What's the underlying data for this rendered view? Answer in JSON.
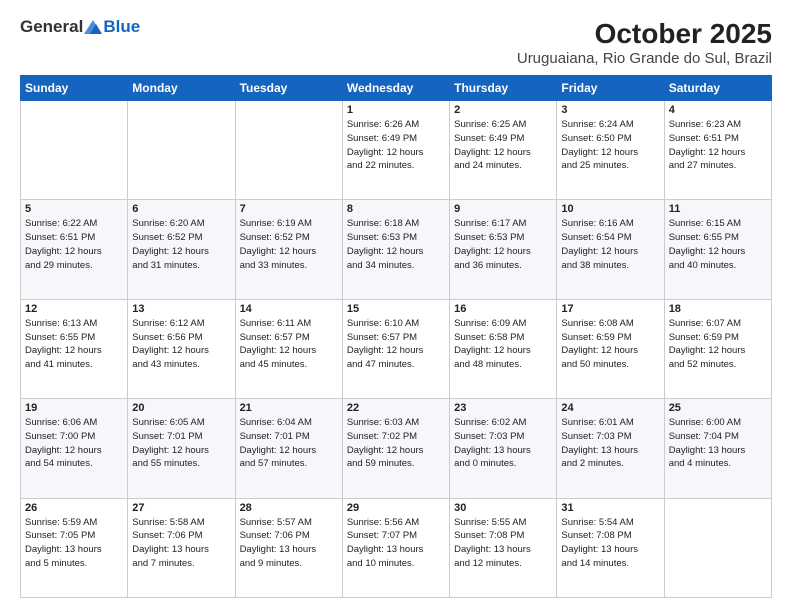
{
  "logo": {
    "general": "General",
    "blue": "Blue"
  },
  "title": "October 2025",
  "subtitle": "Uruguaiana, Rio Grande do Sul, Brazil",
  "headers": [
    "Sunday",
    "Monday",
    "Tuesday",
    "Wednesday",
    "Thursday",
    "Friday",
    "Saturday"
  ],
  "rows": [
    [
      {
        "day": "",
        "info": ""
      },
      {
        "day": "",
        "info": ""
      },
      {
        "day": "",
        "info": ""
      },
      {
        "day": "1",
        "info": "Sunrise: 6:26 AM\nSunset: 6:49 PM\nDaylight: 12 hours\nand 22 minutes."
      },
      {
        "day": "2",
        "info": "Sunrise: 6:25 AM\nSunset: 6:49 PM\nDaylight: 12 hours\nand 24 minutes."
      },
      {
        "day": "3",
        "info": "Sunrise: 6:24 AM\nSunset: 6:50 PM\nDaylight: 12 hours\nand 25 minutes."
      },
      {
        "day": "4",
        "info": "Sunrise: 6:23 AM\nSunset: 6:51 PM\nDaylight: 12 hours\nand 27 minutes."
      }
    ],
    [
      {
        "day": "5",
        "info": "Sunrise: 6:22 AM\nSunset: 6:51 PM\nDaylight: 12 hours\nand 29 minutes."
      },
      {
        "day": "6",
        "info": "Sunrise: 6:20 AM\nSunset: 6:52 PM\nDaylight: 12 hours\nand 31 minutes."
      },
      {
        "day": "7",
        "info": "Sunrise: 6:19 AM\nSunset: 6:52 PM\nDaylight: 12 hours\nand 33 minutes."
      },
      {
        "day": "8",
        "info": "Sunrise: 6:18 AM\nSunset: 6:53 PM\nDaylight: 12 hours\nand 34 minutes."
      },
      {
        "day": "9",
        "info": "Sunrise: 6:17 AM\nSunset: 6:53 PM\nDaylight: 12 hours\nand 36 minutes."
      },
      {
        "day": "10",
        "info": "Sunrise: 6:16 AM\nSunset: 6:54 PM\nDaylight: 12 hours\nand 38 minutes."
      },
      {
        "day": "11",
        "info": "Sunrise: 6:15 AM\nSunset: 6:55 PM\nDaylight: 12 hours\nand 40 minutes."
      }
    ],
    [
      {
        "day": "12",
        "info": "Sunrise: 6:13 AM\nSunset: 6:55 PM\nDaylight: 12 hours\nand 41 minutes."
      },
      {
        "day": "13",
        "info": "Sunrise: 6:12 AM\nSunset: 6:56 PM\nDaylight: 12 hours\nand 43 minutes."
      },
      {
        "day": "14",
        "info": "Sunrise: 6:11 AM\nSunset: 6:57 PM\nDaylight: 12 hours\nand 45 minutes."
      },
      {
        "day": "15",
        "info": "Sunrise: 6:10 AM\nSunset: 6:57 PM\nDaylight: 12 hours\nand 47 minutes."
      },
      {
        "day": "16",
        "info": "Sunrise: 6:09 AM\nSunset: 6:58 PM\nDaylight: 12 hours\nand 48 minutes."
      },
      {
        "day": "17",
        "info": "Sunrise: 6:08 AM\nSunset: 6:59 PM\nDaylight: 12 hours\nand 50 minutes."
      },
      {
        "day": "18",
        "info": "Sunrise: 6:07 AM\nSunset: 6:59 PM\nDaylight: 12 hours\nand 52 minutes."
      }
    ],
    [
      {
        "day": "19",
        "info": "Sunrise: 6:06 AM\nSunset: 7:00 PM\nDaylight: 12 hours\nand 54 minutes."
      },
      {
        "day": "20",
        "info": "Sunrise: 6:05 AM\nSunset: 7:01 PM\nDaylight: 12 hours\nand 55 minutes."
      },
      {
        "day": "21",
        "info": "Sunrise: 6:04 AM\nSunset: 7:01 PM\nDaylight: 12 hours\nand 57 minutes."
      },
      {
        "day": "22",
        "info": "Sunrise: 6:03 AM\nSunset: 7:02 PM\nDaylight: 12 hours\nand 59 minutes."
      },
      {
        "day": "23",
        "info": "Sunrise: 6:02 AM\nSunset: 7:03 PM\nDaylight: 13 hours\nand 0 minutes."
      },
      {
        "day": "24",
        "info": "Sunrise: 6:01 AM\nSunset: 7:03 PM\nDaylight: 13 hours\nand 2 minutes."
      },
      {
        "day": "25",
        "info": "Sunrise: 6:00 AM\nSunset: 7:04 PM\nDaylight: 13 hours\nand 4 minutes."
      }
    ],
    [
      {
        "day": "26",
        "info": "Sunrise: 5:59 AM\nSunset: 7:05 PM\nDaylight: 13 hours\nand 5 minutes."
      },
      {
        "day": "27",
        "info": "Sunrise: 5:58 AM\nSunset: 7:06 PM\nDaylight: 13 hours\nand 7 minutes."
      },
      {
        "day": "28",
        "info": "Sunrise: 5:57 AM\nSunset: 7:06 PM\nDaylight: 13 hours\nand 9 minutes."
      },
      {
        "day": "29",
        "info": "Sunrise: 5:56 AM\nSunset: 7:07 PM\nDaylight: 13 hours\nand 10 minutes."
      },
      {
        "day": "30",
        "info": "Sunrise: 5:55 AM\nSunset: 7:08 PM\nDaylight: 13 hours\nand 12 minutes."
      },
      {
        "day": "31",
        "info": "Sunrise: 5:54 AM\nSunset: 7:08 PM\nDaylight: 13 hours\nand 14 minutes."
      },
      {
        "day": "",
        "info": ""
      }
    ]
  ]
}
